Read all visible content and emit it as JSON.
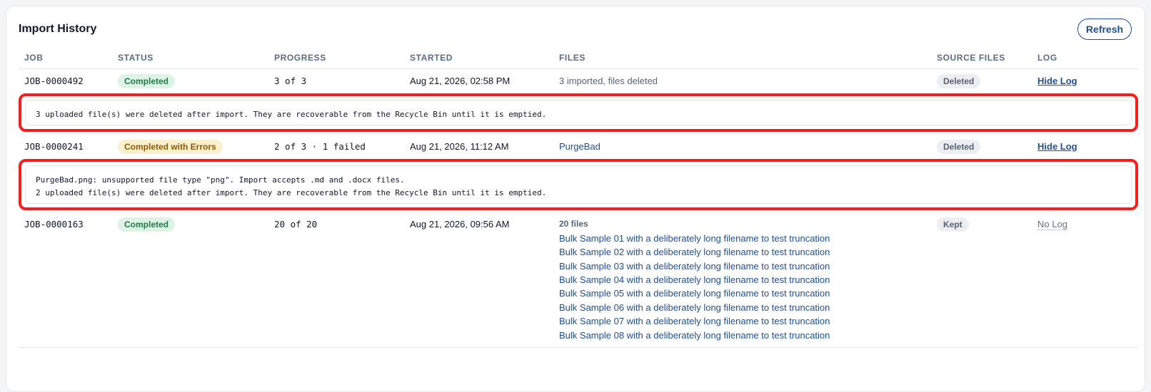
{
  "panel": {
    "title": "Import History",
    "refresh_label": "Refresh"
  },
  "columns": [
    "JOB",
    "STATUS",
    "PROGRESS",
    "STARTED",
    "FILES",
    "SOURCE FILES",
    "LOG"
  ],
  "jobs": [
    {
      "job": "JOB-0000492",
      "status": "Completed",
      "progress": "3 of 3",
      "started": "Aug 21, 2026, 02:58 PM",
      "files_summary": "3 imported, files deleted",
      "source_files": "Deleted",
      "log_action": "Hide Log",
      "log_lines": [
        "3 uploaded file(s) were deleted after import. They are recoverable from the Recycle Bin until it is emptied."
      ]
    },
    {
      "job": "JOB-0000241",
      "status": "Completed with Errors",
      "progress": "2 of 3 · 1 failed",
      "started": "Aug 21, 2026, 11:12 AM",
      "files_summary": "PurgeBad",
      "source_files": "Deleted",
      "log_action": "Hide Log",
      "log_lines": [
        "PurgeBad.png: unsupported file type \"png\". Import accepts .md and .docx files.",
        "2 uploaded file(s) were deleted after import. They are recoverable from the Recycle Bin until it is emptied."
      ]
    },
    {
      "job": "JOB-0000163",
      "status": "Completed",
      "progress": "20 of 20",
      "started": "Aug 21, 2026, 09:56 AM",
      "files_count": "20 files",
      "files": [
        "Bulk Sample 01 with a deliberately long filename to test truncation",
        "Bulk Sample 02 with a deliberately long filename to test truncation",
        "Bulk Sample 03 with a deliberately long filename to test truncation",
        "Bulk Sample 04 with a deliberately long filename to test truncation",
        "Bulk Sample 05 with a deliberately long filename to test truncation",
        "Bulk Sample 06 with a deliberately long filename to test truncation",
        "Bulk Sample 07 with a deliberately long filename to test truncation",
        "Bulk Sample 08 with a deliberately long filename to test truncation"
      ],
      "source_files": "Kept",
      "log_action": "No Log"
    }
  ],
  "colors": {
    "accent": "#1e4f8f",
    "highlight": "#ff1a1a",
    "success_bg": "#dcf3e5",
    "warning_bg": "#fbf0cc"
  }
}
